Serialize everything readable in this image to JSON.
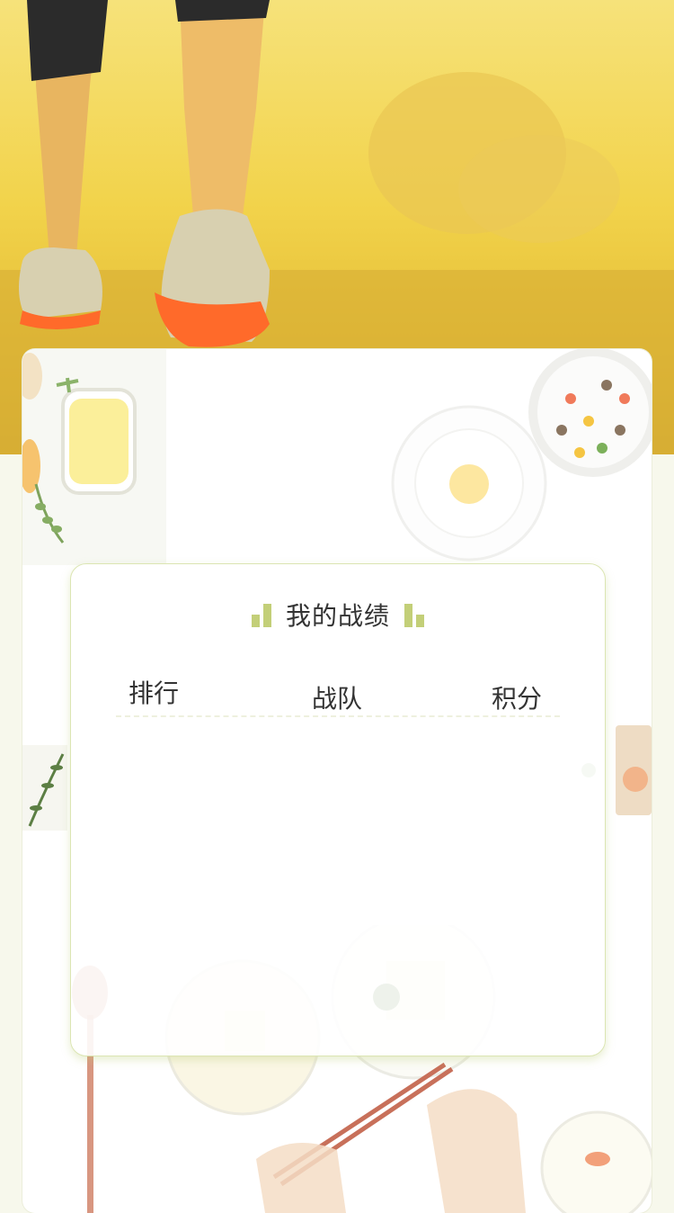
{
  "stats_card": {
    "title": "我的战绩",
    "columns": [
      "排行",
      "战队",
      "积分"
    ],
    "rows": []
  },
  "colors": {
    "accent": "#c3cf78",
    "hero_yellow": "#f2d34b",
    "shoe_orange": "#ff6a2a",
    "page_bg": "#f7f8ec"
  }
}
